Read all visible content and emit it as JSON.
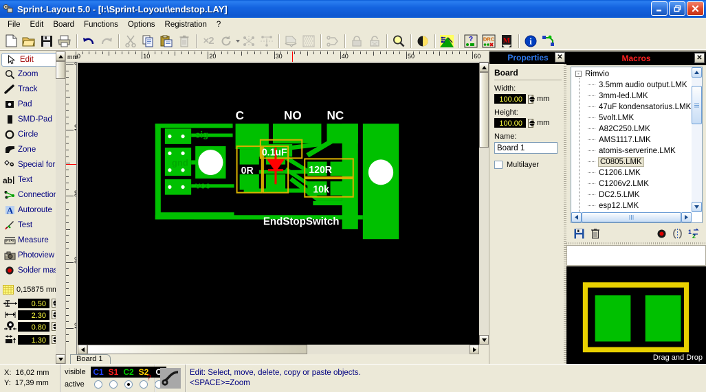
{
  "window": {
    "title": "Sprint-Layout 5.0 - [I:\\Sprint-Loyout\\endstop.LAY]",
    "app_icon": "pad-icon",
    "minimize_label": "_",
    "restore_label": "❐",
    "close_label": "✕"
  },
  "menu": {
    "items": [
      {
        "label": "File"
      },
      {
        "label": "Edit"
      },
      {
        "label": "Board"
      },
      {
        "label": "Functions"
      },
      {
        "label": "Options"
      },
      {
        "label": "Registration"
      },
      {
        "label": "?"
      }
    ]
  },
  "toolbar": {
    "buttons": [
      {
        "name": "new-file-icon",
        "enabled": true
      },
      {
        "name": "open-folder-icon",
        "enabled": true
      },
      {
        "name": "save-disk-icon",
        "enabled": true
      },
      {
        "name": "print-icon",
        "enabled": true
      },
      {
        "name": "undo-icon",
        "enabled": true
      },
      {
        "name": "redo-icon",
        "enabled": false
      },
      {
        "name": "cut-scissors-icon",
        "enabled": false
      },
      {
        "name": "copy-icon",
        "enabled": true
      },
      {
        "name": "paste-icon",
        "enabled": true
      },
      {
        "name": "delete-trash-icon",
        "enabled": false
      },
      {
        "name": "duplicate-x2-icon",
        "enabled": false,
        "label": "×2"
      },
      {
        "name": "rotate-icon",
        "enabled": false
      },
      {
        "name": "mirror-horizontal-icon",
        "enabled": false
      },
      {
        "name": "mirror-vertical-icon",
        "enabled": false
      },
      {
        "name": "group-icon",
        "enabled": false
      },
      {
        "name": "ground-plane-icon",
        "enabled": false
      },
      {
        "name": "macro-create-icon",
        "enabled": false
      },
      {
        "name": "lock-icon",
        "enabled": false
      },
      {
        "name": "unlock-icon",
        "enabled": false
      },
      {
        "name": "zoom-magnifier-icon",
        "enabled": true
      },
      {
        "name": "contrast-icon",
        "enabled": true
      },
      {
        "name": "photoview-icon",
        "enabled": true
      },
      {
        "name": "test-connections-icon",
        "enabled": true
      },
      {
        "name": "drc-check-icon",
        "enabled": true
      },
      {
        "name": "measure-m-icon",
        "enabled": true
      },
      {
        "name": "info-icon",
        "enabled": true
      },
      {
        "name": "autoroute-icon",
        "enabled": true
      }
    ]
  },
  "tools": {
    "items": [
      {
        "label": "Edit",
        "icon": "cursor-arrow-icon",
        "selected": true
      },
      {
        "label": "Zoom",
        "icon": "magnifier-icon",
        "selected": false
      },
      {
        "label": "Track",
        "icon": "track-line-icon",
        "selected": false
      },
      {
        "label": "Pad",
        "icon": "pad-square-icon",
        "selected": false,
        "has_submenu": true
      },
      {
        "label": "SMD-Pad",
        "icon": "smd-pad-icon",
        "selected": false
      },
      {
        "label": "Circle",
        "icon": "circle-icon",
        "selected": false
      },
      {
        "label": "Zone",
        "icon": "zone-icon",
        "selected": false
      },
      {
        "label": "Special form",
        "icon": "special-form-icon",
        "selected": false
      },
      {
        "label": "Text",
        "icon": "text-ab-icon",
        "selected": false
      },
      {
        "label": "Connections",
        "icon": "connections-icon",
        "selected": false
      },
      {
        "label": "Autoroute",
        "icon": "autoroute-a-icon",
        "selected": false
      },
      {
        "label": "Test",
        "icon": "test-probe-icon",
        "selected": false
      },
      {
        "label": "Measure",
        "icon": "ruler-icon",
        "selected": false
      },
      {
        "label": "Photoview",
        "icon": "camera-icon",
        "selected": false
      },
      {
        "label": "Solder mask",
        "icon": "solder-mask-dot-icon",
        "selected": false
      }
    ],
    "grid": {
      "icon": "grid-icon",
      "value": "0,15875 mm"
    },
    "settings": [
      {
        "icon": "track-width-icon",
        "value": "0.50"
      },
      {
        "icon": "pad-outer-icon",
        "value": "2.30"
      },
      {
        "icon": "pad-drill-icon",
        "value": "0.80"
      },
      {
        "icon": "smd-width-icon",
        "value": "1.30"
      }
    ]
  },
  "canvas": {
    "unit_label": "mm",
    "ruler_h_labels": [
      "0",
      "10",
      "20",
      "30",
      "40",
      "50"
    ],
    "ruler_v_labels": [
      "0",
      "10",
      "20",
      "30",
      "40"
    ],
    "marker_x_mm": "16.02",
    "marker_y_mm": "17.39",
    "tab_label": "Board 1",
    "board_bg": "#000000",
    "copper_color": "#00c000",
    "silk_color": "#ffffff",
    "component_outline_color": "#d8b000",
    "pads": [
      {
        "label": "C"
      },
      {
        "label": "NO"
      },
      {
        "label": "NC"
      }
    ],
    "silk_texts": [
      "sig",
      "gnd",
      "vcc",
      "0R",
      "0.1uF",
      "120R",
      "10k",
      "EndStopSwitch"
    ]
  },
  "properties": {
    "title": "Properties",
    "close_label": "✕",
    "section": "Board",
    "width_label": "Width:",
    "width_value": "100.00",
    "width_unit": "mm",
    "height_label": "Height:",
    "height_value": "100.00",
    "height_unit": "mm",
    "name_label": "Name:",
    "name_value": "Board 1",
    "multilayer_label": "Multilayer",
    "multilayer_checked": false
  },
  "macros": {
    "title": "Macros",
    "close_label": "✕",
    "root": {
      "label": "Rimvio",
      "expanded": true,
      "toggle": "-"
    },
    "items": [
      {
        "label": "3.5mm audio output.LMK",
        "selected": false
      },
      {
        "label": "3mm-led.LMK",
        "selected": false
      },
      {
        "label": "47uF kondensatorius.LMK",
        "selected": false
      },
      {
        "label": "5volt.LMK",
        "selected": false
      },
      {
        "label": "A82C250.LMK",
        "selected": false
      },
      {
        "label": "AMS1117.LMK",
        "selected": false
      },
      {
        "label": "atomis-serverine.LMK",
        "selected": false
      },
      {
        "label": "C0805.LMK",
        "selected": true
      },
      {
        "label": "C1206.LMK",
        "selected": false
      },
      {
        "label": "C1206v2.LMK",
        "selected": false
      },
      {
        "label": "DC2.5.LMK",
        "selected": false
      },
      {
        "label": "esp12.LMK",
        "selected": false
      }
    ],
    "toolbar": [
      {
        "name": "save-macro-icon"
      },
      {
        "name": "delete-macro-icon"
      },
      {
        "name": "solder-mask-icon"
      },
      {
        "name": "mirror-macro-icon"
      },
      {
        "name": "rotate-order-icon"
      }
    ],
    "preview_hint": "Drag and Drop",
    "scroll_left_label": "‹",
    "scroll_right_label": "›",
    "scroll_up_label": "⌃",
    "scroll_down_label": "⌄"
  },
  "statusbar": {
    "x_label": "X:",
    "x_value": "16,02 mm",
    "y_label": "Y:",
    "y_value": "17,39 mm",
    "visible_label": "visible",
    "active_label": "active",
    "help_label": "?",
    "layers": [
      {
        "label": "C1",
        "color": "#2040ff",
        "active": false
      },
      {
        "label": "S1",
        "color": "#ff2020",
        "active": false
      },
      {
        "label": "C2",
        "color": "#00d000",
        "active": true
      },
      {
        "label": "S2",
        "color": "#ffd000",
        "active": false
      },
      {
        "label": "O",
        "color": "#ffffff",
        "active": false
      }
    ],
    "mode_icon": "track-mode-icon",
    "hint_line1": "Edit: Select, move, delete, copy or paste objects.",
    "hint_line2": "<SPACE>=Zoom"
  }
}
